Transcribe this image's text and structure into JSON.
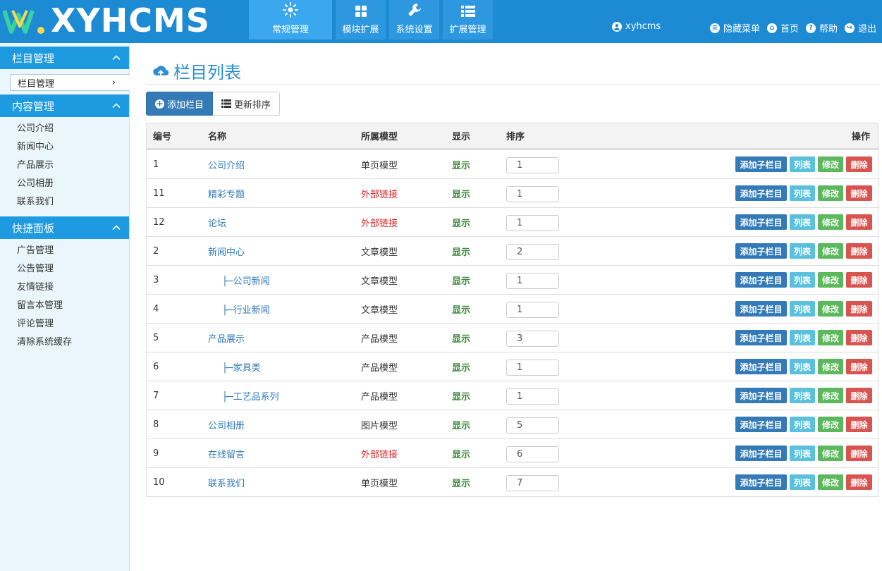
{
  "header": {
    "logo_text": "XYHCMS",
    "nav": [
      {
        "label": "常规管理",
        "icon": "sun-icon",
        "active": true
      },
      {
        "label": "模块扩展",
        "icon": "grid-icon",
        "active": false
      },
      {
        "label": "系统设置",
        "icon": "wrench-icon",
        "active": false
      },
      {
        "label": "扩展管理",
        "icon": "list-icon",
        "active": false
      }
    ],
    "username": "xyhcms",
    "links": {
      "hide_menu": "隐藏菜单",
      "home": "首页",
      "help": "帮助",
      "logout": "退出"
    }
  },
  "sidebar": {
    "groups": [
      {
        "title": "栏目管理",
        "items": [
          "栏目管理"
        ]
      },
      {
        "title": "内容管理",
        "items": [
          "公司介绍",
          "新闻中心",
          "产品展示",
          "公司相册",
          "联系我们"
        ]
      },
      {
        "title": "快捷面板",
        "items": [
          "广告管理",
          "公告管理",
          "友情链接",
          "留言本管理",
          "评论管理",
          "清除系统缓存"
        ]
      }
    ]
  },
  "main": {
    "title": "栏目列表",
    "add_button": "添加栏目",
    "update_sort_button": "更新排序",
    "columns": {
      "id": "编号",
      "name": "名称",
      "model": "所属模型",
      "show": "显示",
      "sort": "排序",
      "ops": "操作"
    },
    "ops": {
      "add_child": "添加子栏目",
      "list": "列表",
      "edit": "修改",
      "delete": "删除"
    },
    "rows": [
      {
        "id": "1",
        "name": "公司介绍",
        "model": "单页模型",
        "show": "显示",
        "sort": "1"
      },
      {
        "id": "11",
        "name": "精彩专题",
        "model": "外部链接",
        "show": "显示",
        "sort": "1"
      },
      {
        "id": "12",
        "name": "论坛",
        "model": "外部链接",
        "show": "显示",
        "sort": "1"
      },
      {
        "id": "2",
        "name": "新闻中心",
        "model": "文章模型",
        "show": "显示",
        "sort": "2"
      },
      {
        "id": "3",
        "name": "├─公司新闻",
        "model": "文章模型",
        "show": "显示",
        "sort": "1"
      },
      {
        "id": "4",
        "name": "├─行业新闻",
        "model": "文章模型",
        "show": "显示",
        "sort": "1"
      },
      {
        "id": "5",
        "name": "产品展示",
        "model": "产品模型",
        "show": "显示",
        "sort": "3"
      },
      {
        "id": "6",
        "name": "├─家具类",
        "model": "产品模型",
        "show": "显示",
        "sort": "1"
      },
      {
        "id": "7",
        "name": "├─工艺品系列",
        "model": "产品模型",
        "show": "显示",
        "sort": "1"
      },
      {
        "id": "8",
        "name": "公司相册",
        "model": "图片模型",
        "show": "显示",
        "sort": "5"
      },
      {
        "id": "9",
        "name": "在线留言",
        "model": "外部链接",
        "show": "显示",
        "sort": "6"
      },
      {
        "id": "10",
        "name": "联系我们",
        "model": "单页模型",
        "show": "显示",
        "sort": "7"
      }
    ]
  },
  "colors": {
    "header_bg": "#1d8ad4",
    "sidebar_head_bg": "#1d9ae0",
    "link_red": "#d42222",
    "show_green": "#3a8a3a"
  }
}
